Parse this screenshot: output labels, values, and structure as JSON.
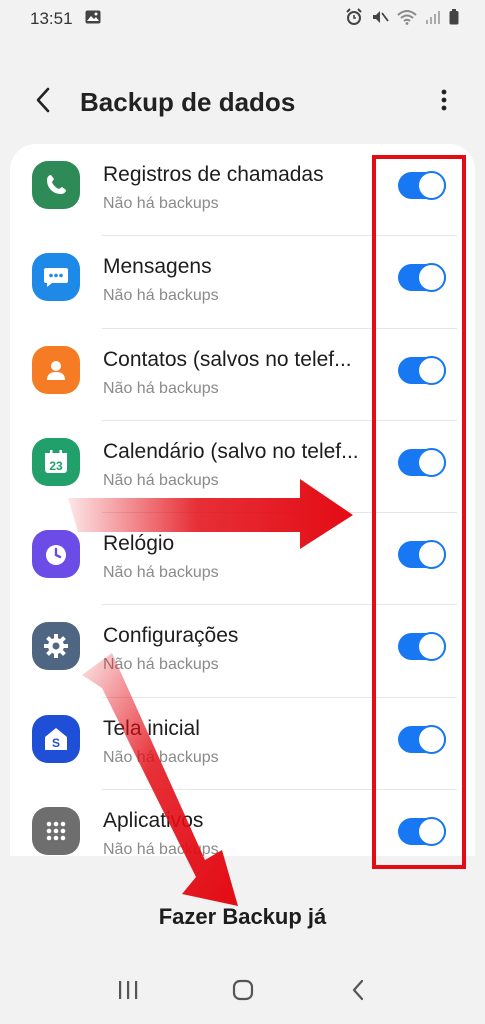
{
  "status_bar": {
    "time": "13:51",
    "left_icons": [
      "image-icon"
    ],
    "right_icons": [
      "alarm-icon",
      "mute-icon",
      "wifi-icon",
      "signal-icon",
      "battery-icon"
    ]
  },
  "header": {
    "title": "Backup de dados",
    "back_icon": "chevron-left-icon",
    "more_icon": "more-vert-icon"
  },
  "items": [
    {
      "title": "Registros de chamadas",
      "subtitle": "Não há backups",
      "icon": "phone-icon",
      "color": "#2e8b57",
      "on": true
    },
    {
      "title": "Mensagens",
      "subtitle": "Não há backups",
      "icon": "message-icon",
      "color": "#1d8ae8",
      "on": true
    },
    {
      "title": "Contatos (salvos no telef...",
      "subtitle": "Não há backups",
      "icon": "contact-icon",
      "color": "#f57c24",
      "on": true
    },
    {
      "title": "Calendário (salvo no telef...",
      "subtitle": "Não há backups",
      "icon": "calendar-icon",
      "color": "#22a06b",
      "on": true
    },
    {
      "title": "Relógio",
      "subtitle": "Não há backups",
      "icon": "clock-icon",
      "color": "#6b4ce6",
      "on": true
    },
    {
      "title": "Configurações",
      "subtitle": "Não há backups",
      "icon": "gear-icon",
      "color": "#4f6682",
      "on": true
    },
    {
      "title": "Tela inicial",
      "subtitle": "Não há backups",
      "icon": "home-icon",
      "color": "#1f4fd6",
      "on": true
    },
    {
      "title": "Aplicativos",
      "subtitle": "Não há backups",
      "icon": "apps-icon",
      "color": "#6e6e6e",
      "on": true
    }
  ],
  "calendar_day": "23",
  "backup_button": {
    "label": "Fazer Backup já"
  },
  "colors": {
    "accent": "#1877f2",
    "annotation": "#e30b14"
  },
  "nav": [
    "recents-icon",
    "home-nav-icon",
    "back-nav-icon"
  ]
}
